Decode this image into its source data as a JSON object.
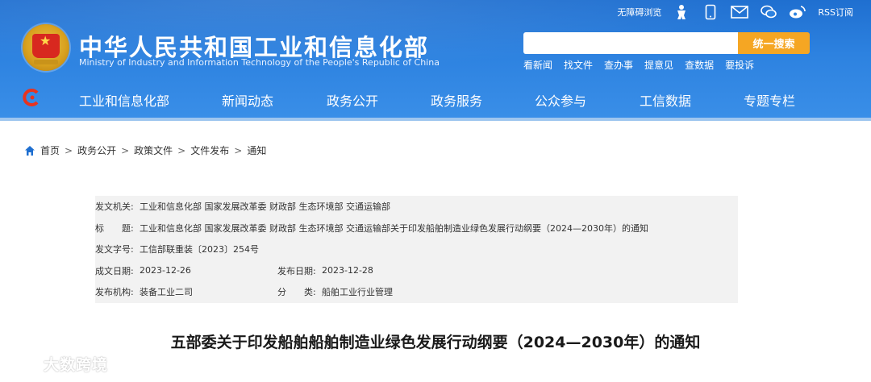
{
  "header": {
    "site_title": "中华人民共和国工业和信息化部",
    "site_subtitle": "Ministry of Industry and Information Technology of the People's Republic of China",
    "top_links": {
      "accessibility": "无障碍浏览",
      "rss": "RSS订阅"
    },
    "search": {
      "placeholder": "",
      "button_label": "统一搜索"
    },
    "quick_links": [
      "看新闻",
      "找文件",
      "查办事",
      "提意见",
      "查数据",
      "要投诉"
    ],
    "nav": [
      "工业和信息化部",
      "新闻动态",
      "政务公开",
      "政务服务",
      "公众参与",
      "工信数据",
      "专题专栏"
    ],
    "colors": {
      "header_blue": "#2d82e0",
      "search_button": "#f5a623"
    }
  },
  "breadcrumb": [
    "首页",
    "政务公开",
    "政策文件",
    "文件发布",
    "通知"
  ],
  "info": {
    "issuer_label": "发文机关:",
    "issuer_value": "工业和信息化部 国家发展改革委 财政部 生态环境部 交通运输部",
    "title_label": "标　　题:",
    "title_value": "工业和信息化部 国家发展改革委 财政部 生态环境部 交通运输部关于印发船舶制造业绿色发展行动纲要（2024—2030年）的通知",
    "doc_no_label": "发文字号:",
    "doc_no_value": "工信部联重装〔2023〕254号",
    "created_label": "成文日期:",
    "created_value": "2023-12-26",
    "published_label": "发布日期:",
    "published_value": "2023-12-28",
    "agency_label": "发布机构:",
    "agency_value": "装备工业二司",
    "category_label": "分　　类:",
    "category_value": "船舶工业行业管理"
  },
  "article_title": "五部委关于印发船舶船舶制造业绿色发展行动纲要（2024—2030年）的通知",
  "watermark": "大数跨境"
}
